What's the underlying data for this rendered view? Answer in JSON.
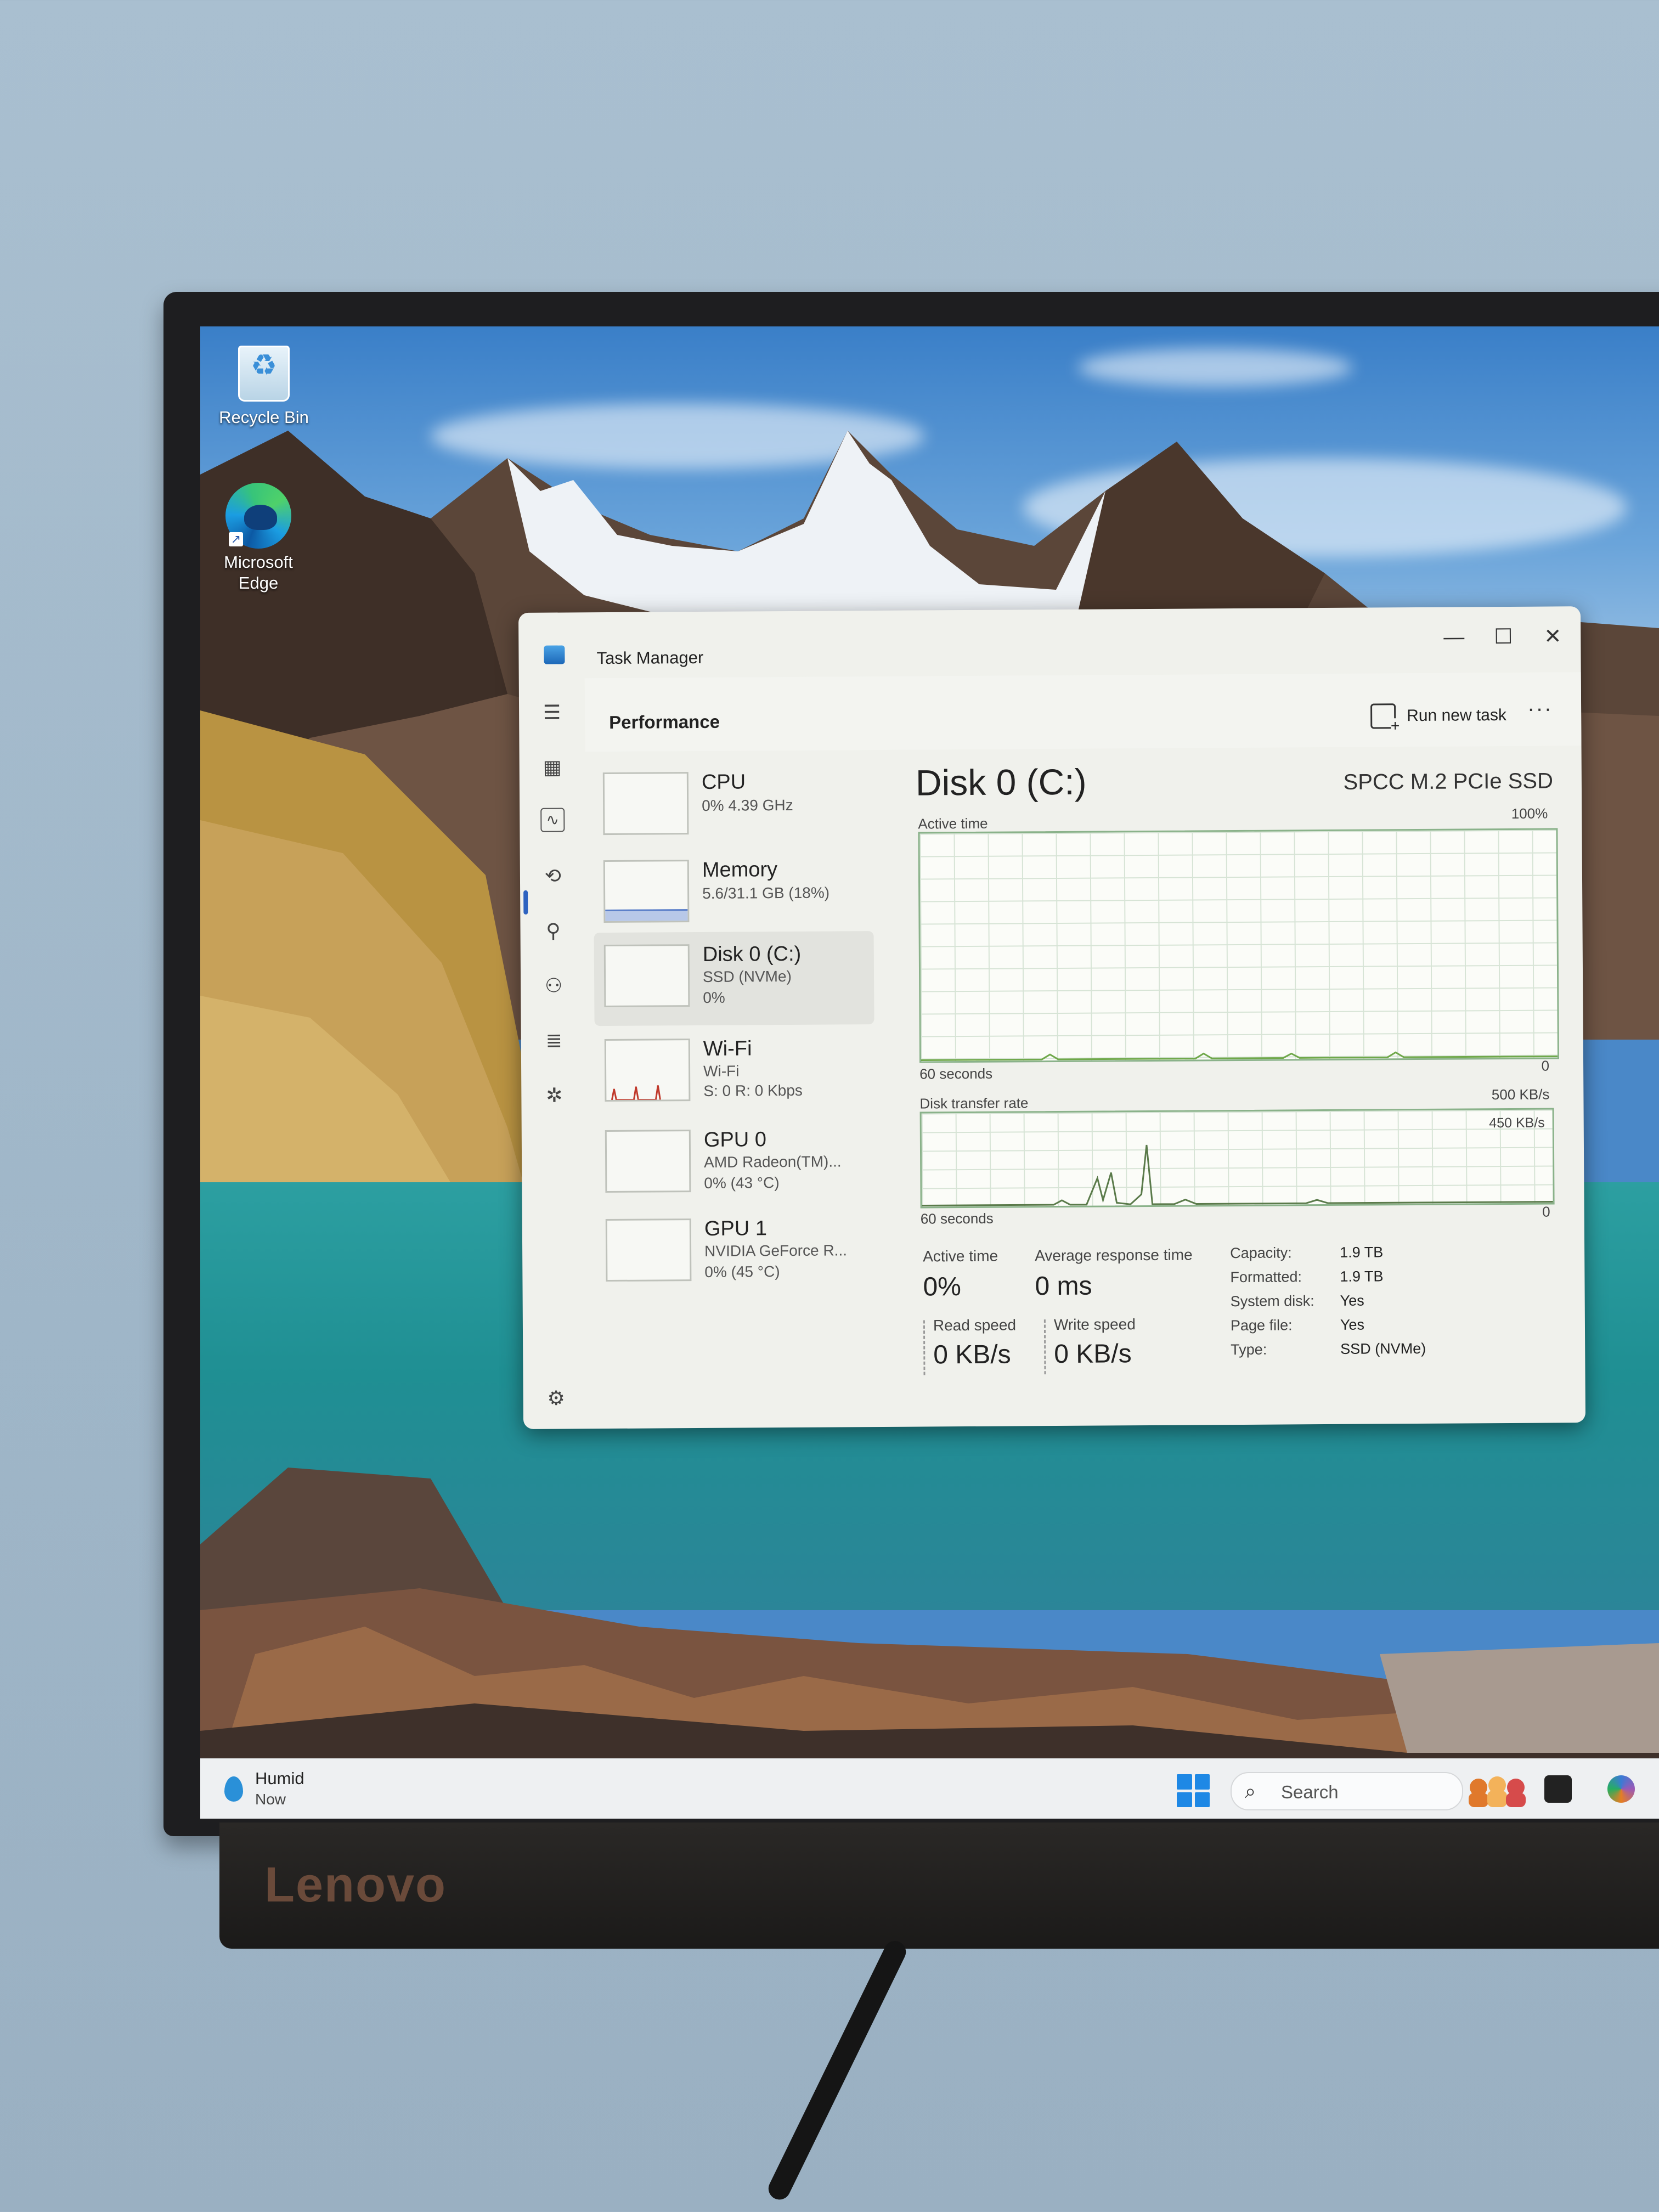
{
  "desktop": {
    "icons": [
      {
        "label": "Recycle Bin"
      },
      {
        "label": "Microsoft Edge"
      }
    ]
  },
  "monitor": {
    "brand": "Lenovo"
  },
  "task_manager": {
    "window_title": "Task Manager",
    "window_controls": {
      "minimize": "—",
      "maximize": "☐",
      "close": "✕"
    },
    "section_title": "Performance",
    "run_new_task_label": "Run new task",
    "more_label": "···",
    "nav_icons": [
      "hamburger-icon",
      "processes-icon",
      "performance-icon",
      "app-history-icon",
      "startup-apps-icon",
      "users-icon",
      "details-icon",
      "services-icon",
      "settings-icon"
    ],
    "items": [
      {
        "name": "CPU",
        "sub1": "0% 4.39 GHz",
        "sub2": "",
        "sub3": ""
      },
      {
        "name": "Memory",
        "sub1": "5.6/31.1 GB (18%)",
        "sub2": "",
        "sub3": ""
      },
      {
        "name": "Disk 0 (C:)",
        "sub1": "SSD (NVMe)",
        "sub2": "0%",
        "sub3": ""
      },
      {
        "name": "Wi-Fi",
        "sub1": "Wi-Fi",
        "sub2": "S: 0 R: 0 Kbps",
        "sub3": ""
      },
      {
        "name": "GPU 0",
        "sub1": "AMD Radeon(TM)...",
        "sub2": "0% (43 °C)",
        "sub3": ""
      },
      {
        "name": "GPU 1",
        "sub1": "NVIDIA GeForce R...",
        "sub2": "0% (45 °C)",
        "sub3": ""
      }
    ],
    "selected_index": 2,
    "detail": {
      "title": "Disk 0 (C:)",
      "model": "SPCC M.2 PCIe SSD",
      "graph1": {
        "label": "Active time",
        "max": "100%",
        "time_label": "60 seconds",
        "min": "0"
      },
      "graph2": {
        "label": "Disk transfer rate",
        "max": "500 KB/s",
        "inner_max": "450 KB/s",
        "time_label": "60 seconds",
        "min": "0"
      },
      "stats": {
        "active_time_label": "Active time",
        "active_time_value": "0%",
        "avg_response_label": "Average response time",
        "avg_response_value": "0 ms",
        "read_speed_label": "Read speed",
        "read_speed_value": "0 KB/s",
        "write_speed_label": "Write speed",
        "write_speed_value": "0 KB/s"
      },
      "properties": [
        {
          "key": "Capacity:",
          "value": "1.9 TB"
        },
        {
          "key": "Formatted:",
          "value": "1.9 TB"
        },
        {
          "key": "System disk:",
          "value": "Yes"
        },
        {
          "key": "Page file:",
          "value": "Yes"
        },
        {
          "key": "Type:",
          "value": "SSD (NVMe)"
        }
      ]
    }
  },
  "taskbar": {
    "weather_title": "Humid",
    "weather_sub": "Now",
    "search_placeholder": "Search"
  },
  "colors": {
    "accent": "#2e63c0",
    "graph_border": "#8ab28a",
    "taskbar_bg": "#eef0f2"
  }
}
